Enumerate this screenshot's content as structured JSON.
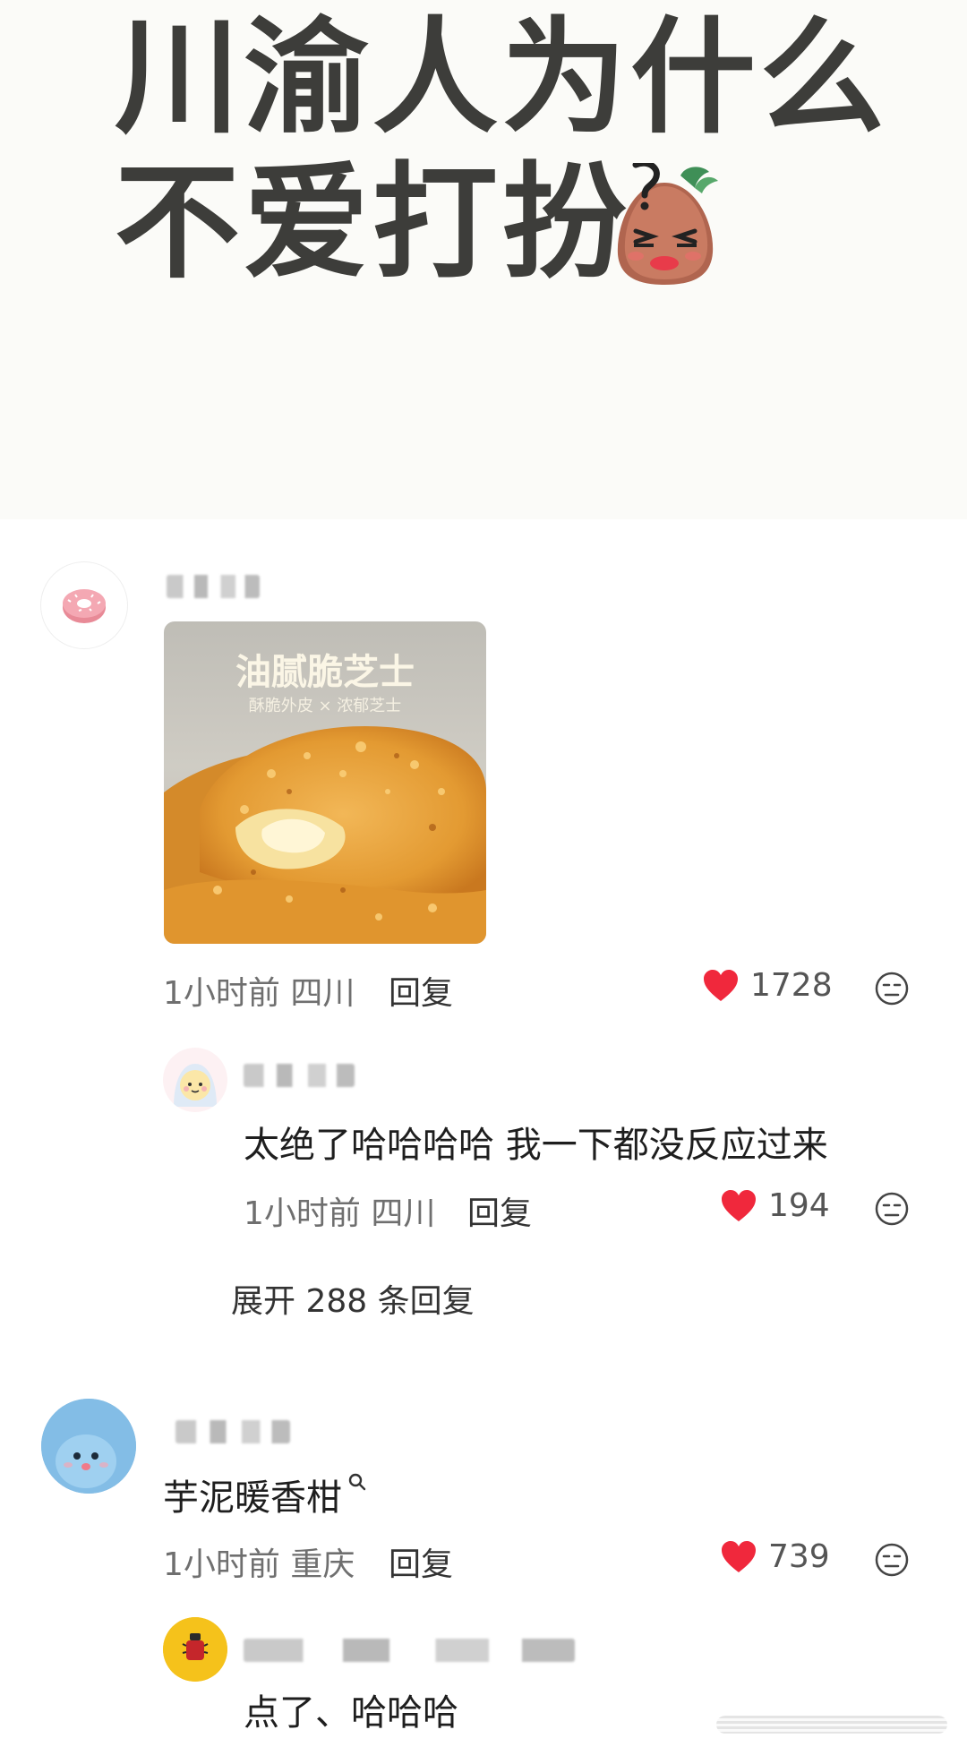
{
  "post": {
    "title_line1": "川渝人为什么",
    "title_line2": "不爱打扮"
  },
  "comments": [
    {
      "image": {
        "title": "油腻脆芝士",
        "subtitle": "酥脆外皮 × 浓郁芝士"
      },
      "time": "1小时前",
      "location": "四川",
      "reply_label": "回复",
      "likes": "1728",
      "replies": [
        {
          "text": "太绝了哈哈哈哈 我一下都没反应过来",
          "time": "1小时前",
          "location": "四川",
          "reply_label": "回复",
          "likes": "194"
        }
      ],
      "expand_label": "展开 288 条回复"
    },
    {
      "text": "芋泥暖香柑",
      "time": "1小时前",
      "location": "重庆",
      "reply_label": "回复",
      "likes": "739",
      "replies": [
        {
          "text": "点了、哈哈哈"
        }
      ]
    }
  ],
  "colors": {
    "heart": "#f0283c",
    "title": "#3d3d3a",
    "meta": "#6f6f6f"
  },
  "icons": {
    "like": "heart-icon",
    "dislike": "dislike-face-icon",
    "search": "search-icon"
  }
}
